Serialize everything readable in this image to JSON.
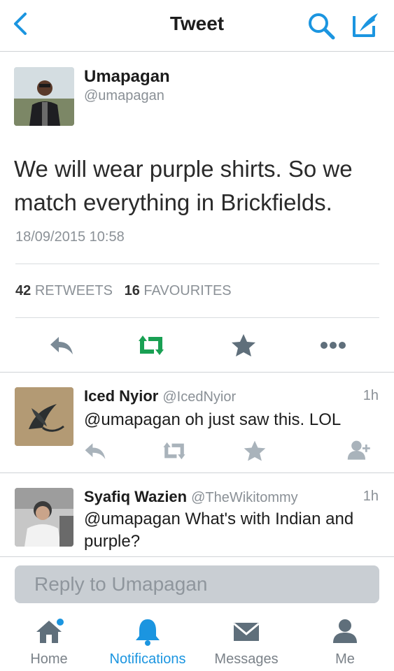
{
  "header": {
    "title": "Tweet",
    "back_icon": "chevron-left-icon",
    "search_icon": "search-icon",
    "compose_icon": "compose-icon"
  },
  "tweet": {
    "author_name": "Umapagan",
    "author_handle": "@umapagan",
    "text": "We will wear purple shirts. So we match everything in Brickfields.",
    "timestamp": "18/09/2015 10:58",
    "retweets_count": "42",
    "retweets_label": "RETWEETS",
    "favourites_count": "16",
    "favourites_label": "FAVOURITES",
    "actions": [
      "reply-icon",
      "retweet-icon",
      "favourite-icon",
      "more-icon"
    ]
  },
  "replies": [
    {
      "name": "Iced Nyior",
      "handle": "@IcedNyior",
      "time": "1h",
      "text": "@umapagan oh just saw this. LOL",
      "actions": [
        "reply-icon",
        "retweet-icon",
        "favourite-icon",
        "follow-icon"
      ]
    },
    {
      "name": "Syafiq Wazien",
      "handle": "@TheWikitommy",
      "time": "1h",
      "text": "@umapagan What's with Indian and purple?"
    }
  ],
  "reply_bar": {
    "placeholder": "Reply to Umapagan"
  },
  "tabbar": {
    "tabs": [
      {
        "label": "Home",
        "icon": "home-icon"
      },
      {
        "label": "Notifications",
        "icon": "bell-icon"
      },
      {
        "label": "Messages",
        "icon": "envelope-icon"
      },
      {
        "label": "Me",
        "icon": "person-icon"
      }
    ],
    "active_tab": "Notifications"
  },
  "colors": {
    "accent": "#1b95e0",
    "retweet_green": "#19a053",
    "icon_gray": "#7b8a96",
    "muted_text": "#8b9197"
  }
}
